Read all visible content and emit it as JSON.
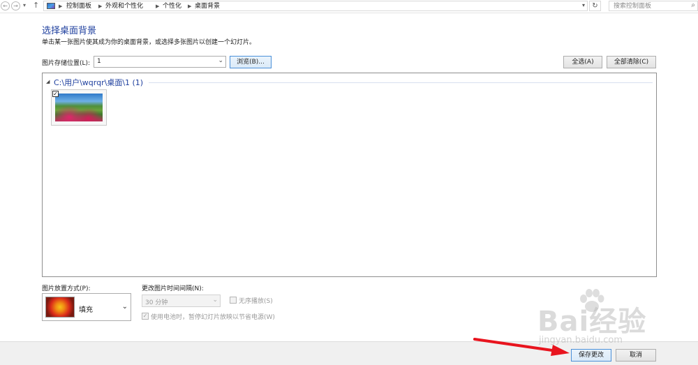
{
  "address_bar": {
    "breadcrumbs": [
      "控制面板",
      "外观和个性化",
      "个性化",
      "桌面背景"
    ],
    "search_placeholder": "搜索控制面板"
  },
  "header": {
    "title": "选择桌面背景",
    "description": "单击某一张图片使其成为你的桌面背景，或选择多张图片以创建一个幻灯片。"
  },
  "location": {
    "label": "图片存储位置(L):",
    "value": "1",
    "browse_label": "浏览(B)...",
    "select_all_label": "全选(A)",
    "clear_all_label": "全部清除(C)"
  },
  "gallery": {
    "group_title": "C:\\用户\\wqrqr\\桌面\\1 (1)",
    "items": [
      {
        "checked": true
      }
    ]
  },
  "position": {
    "label": "图片放置方式(P):",
    "value": "填充"
  },
  "interval": {
    "label": "更改图片时间间隔(N):",
    "value": "30 分钟",
    "shuffle_label": "无序播放(S)",
    "shuffle_checked": false,
    "battery_label": "使用电池时，暂停幻灯片放映以节省电源(W)",
    "battery_checked": true
  },
  "footer": {
    "save_label": "保存更改",
    "cancel_label": "取消"
  },
  "watermark": {
    "text": "Bai经验",
    "url": "jingyan.baidu.com"
  },
  "colors": {
    "title_blue": "#1e3f9e",
    "annotation_red": "#e8141e",
    "footer_bg": "#f0f0f0"
  },
  "icons": [
    "back-icon",
    "forward-icon",
    "recent-dropdown-icon",
    "up-icon",
    "control-panel-icon",
    "chevron-down-icon",
    "refresh-icon",
    "search-icon",
    "collapse-triangle-icon",
    "checkbox-icon"
  ]
}
